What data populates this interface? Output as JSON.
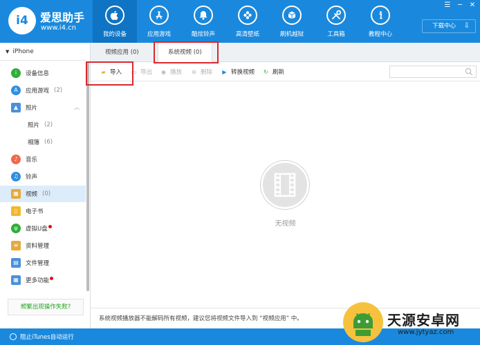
{
  "colors": {
    "brand_blue": "#1a89dd",
    "nav_active": "#0f74c4",
    "highlight_red": "#d8282c",
    "hint_green": "#1fa31f",
    "sidebar_active": "#dcecfa"
  },
  "brand": {
    "name": "爱思助手",
    "url": "www.i4.cn",
    "badge": "i4"
  },
  "nav": [
    {
      "label": "我的设备",
      "icon": "apple-icon",
      "active": true
    },
    {
      "label": "应用游戏",
      "icon": "app-store-icon",
      "active": false
    },
    {
      "label": "酷炫铃声",
      "icon": "bell-icon",
      "active": false
    },
    {
      "label": "高清壁纸",
      "icon": "flower-icon",
      "active": false
    },
    {
      "label": "刷机越狱",
      "icon": "box-icon",
      "active": false
    },
    {
      "label": "工具箱",
      "icon": "tools-icon",
      "active": false
    },
    {
      "label": "教程中心",
      "icon": "info-icon",
      "active": false
    }
  ],
  "window_controls": {
    "menu": "☰",
    "minimize": "─",
    "close": "✕"
  },
  "download_center": {
    "label": "下载中心",
    "icon": "download-icon"
  },
  "sidebar": {
    "device": "iPhone",
    "items": [
      {
        "label": "设备信息",
        "count": "",
        "icon": "info-icon"
      },
      {
        "label": "应用游戏",
        "count": "(2)",
        "icon": "app-store-icon"
      },
      {
        "label": "照片",
        "count": "",
        "icon": "photo-icon"
      },
      {
        "label": "照片",
        "count": "(2)",
        "icon": ""
      },
      {
        "label": "相簿",
        "count": "(6)",
        "icon": ""
      },
      {
        "label": "音乐",
        "count": "",
        "icon": "music-icon"
      },
      {
        "label": "铃声",
        "count": "",
        "icon": "bell-icon"
      },
      {
        "label": "视频",
        "count": "(0)",
        "icon": "video-icon"
      },
      {
        "label": "电子书",
        "count": "",
        "icon": "book-icon"
      },
      {
        "label": "虚拟U盘",
        "count": "",
        "icon": "usb-icon"
      },
      {
        "label": "资料管理",
        "count": "",
        "icon": "contacts-icon"
      },
      {
        "label": "文件管理",
        "count": "",
        "icon": "folder-icon"
      },
      {
        "label": "更多功能",
        "count": "",
        "icon": "grid-icon"
      }
    ],
    "hint_button": "频繁出现操作失败?"
  },
  "tabs": [
    {
      "label": "视频应用 (0)",
      "active": false
    },
    {
      "label": "系统视频 (0)",
      "active": true
    }
  ],
  "toolbar": {
    "import": "导入",
    "export": "导出",
    "play": "播放",
    "delete": "删除",
    "convert": "转换视频",
    "refresh": "刷新"
  },
  "empty_state": {
    "text": "无视频",
    "icon": "film-icon"
  },
  "notice": "系统视频播放器不能解码所有视频，建议您将视频文件导入到 “视频应用” 中。",
  "status": {
    "itunes": "阻止iTunes自动运行"
  },
  "watermark": {
    "title": "天源安卓网",
    "url": "www.jytyaz.com"
  }
}
